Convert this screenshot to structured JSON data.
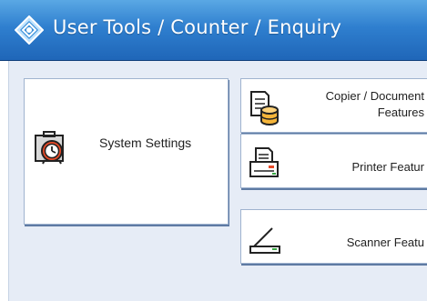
{
  "header": {
    "title": "User Tools / Counter / Enquiry",
    "icon": "diamond-tools-icon"
  },
  "colors": {
    "title_bar": "#2f7fcf",
    "panel": "#e6ecf6",
    "button_border": "#9fb3cf"
  },
  "buttons": {
    "system_settings": {
      "label": "System Settings",
      "icon": "clock-case-icon"
    },
    "copier": {
      "line1": "Copier / Document",
      "line2": "Features",
      "icon": "copier-document-icon"
    },
    "printer": {
      "label": "Printer Featur",
      "icon": "printer-icon"
    },
    "scanner": {
      "label": "Scanner Featu",
      "icon": "scanner-icon"
    }
  }
}
